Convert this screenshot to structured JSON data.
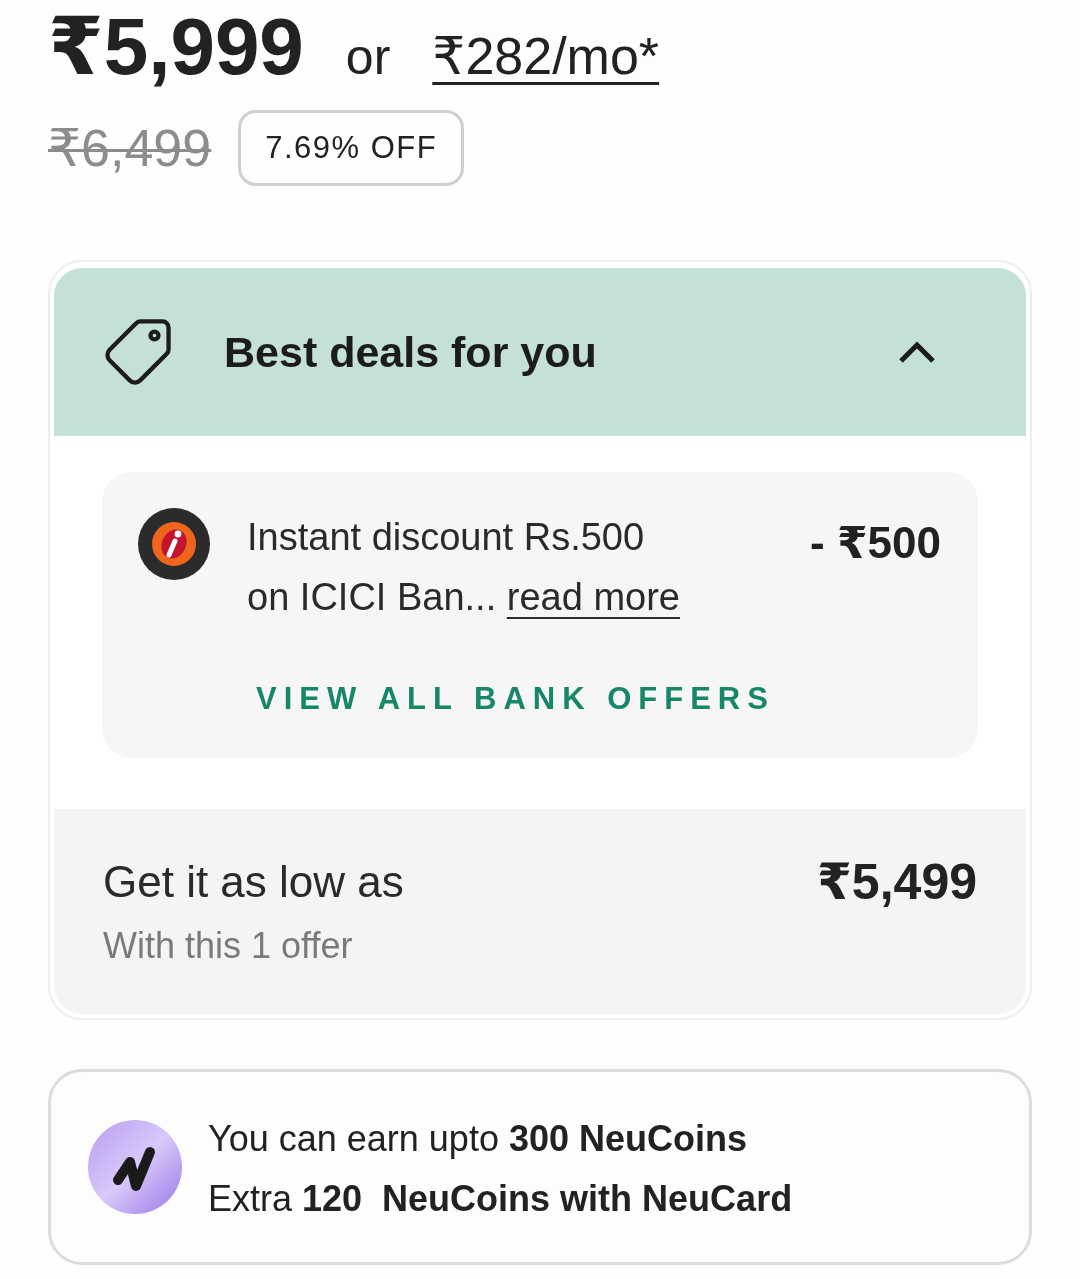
{
  "price": {
    "current": "₹5,999",
    "separator": "or",
    "emi": "₹282/mo*",
    "original": "₹6,499",
    "discount_badge": "7.69% OFF"
  },
  "deals": {
    "title": "Best deals for you",
    "expanded": true,
    "offers": [
      {
        "text": "Instant discount Rs.500 on ICICI Ban...",
        "link": "read more",
        "amount": "- ₹500"
      }
    ],
    "view_all": "VIEW ALL BANK OFFERS",
    "summary": {
      "label": "Get it as low as",
      "sublabel": "With this 1 offer",
      "price": "₹5,499"
    }
  },
  "neucoins": {
    "lines": [
      "You can earn upto **300 NeuCoins**",
      "Extra **120  NeuCoins with NeuCard**"
    ]
  }
}
